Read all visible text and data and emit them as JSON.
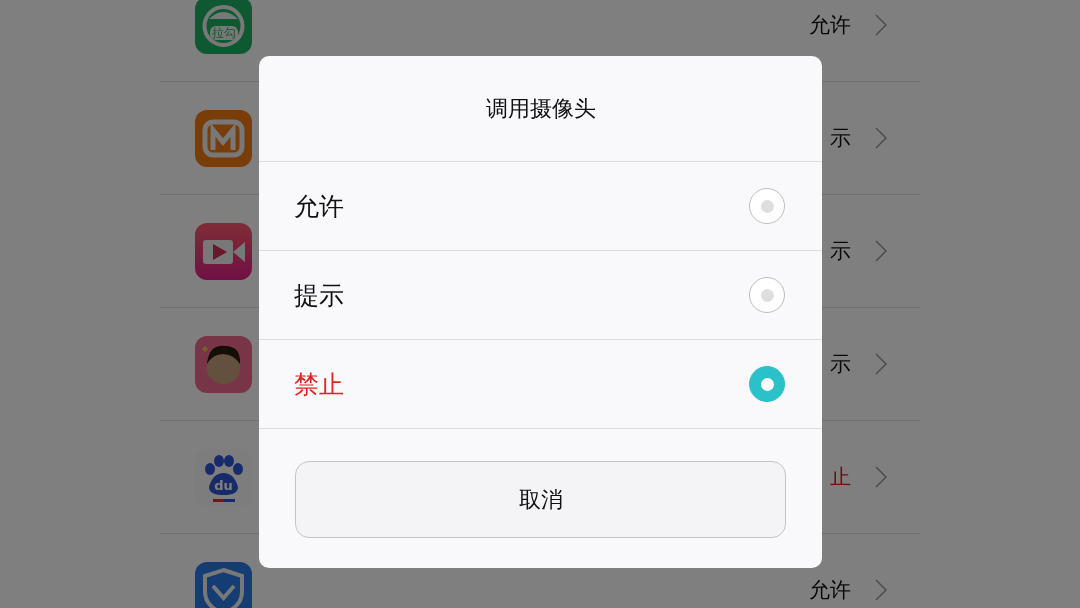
{
  "apps": [
    {
      "kind": "lagou",
      "icon_text": "拉勾",
      "value": "允许",
      "denied": false
    },
    {
      "kind": "mango",
      "value": "示",
      "denied": false
    },
    {
      "kind": "video",
      "value": "示",
      "denied": false
    },
    {
      "kind": "cartoon",
      "value": "示",
      "denied": false
    },
    {
      "kind": "baidu",
      "icon_text": "du",
      "value": "止",
      "denied": true
    },
    {
      "kind": "shield",
      "value": "允许",
      "denied": false
    }
  ],
  "dialog": {
    "title": "调用摄像头",
    "options": [
      {
        "label": "允许",
        "selected": false,
        "kind": "plain"
      },
      {
        "label": "提示",
        "selected": false,
        "kind": "plain"
      },
      {
        "label": "禁止",
        "selected": true,
        "kind": "danger"
      }
    ],
    "cancel": "取消"
  }
}
